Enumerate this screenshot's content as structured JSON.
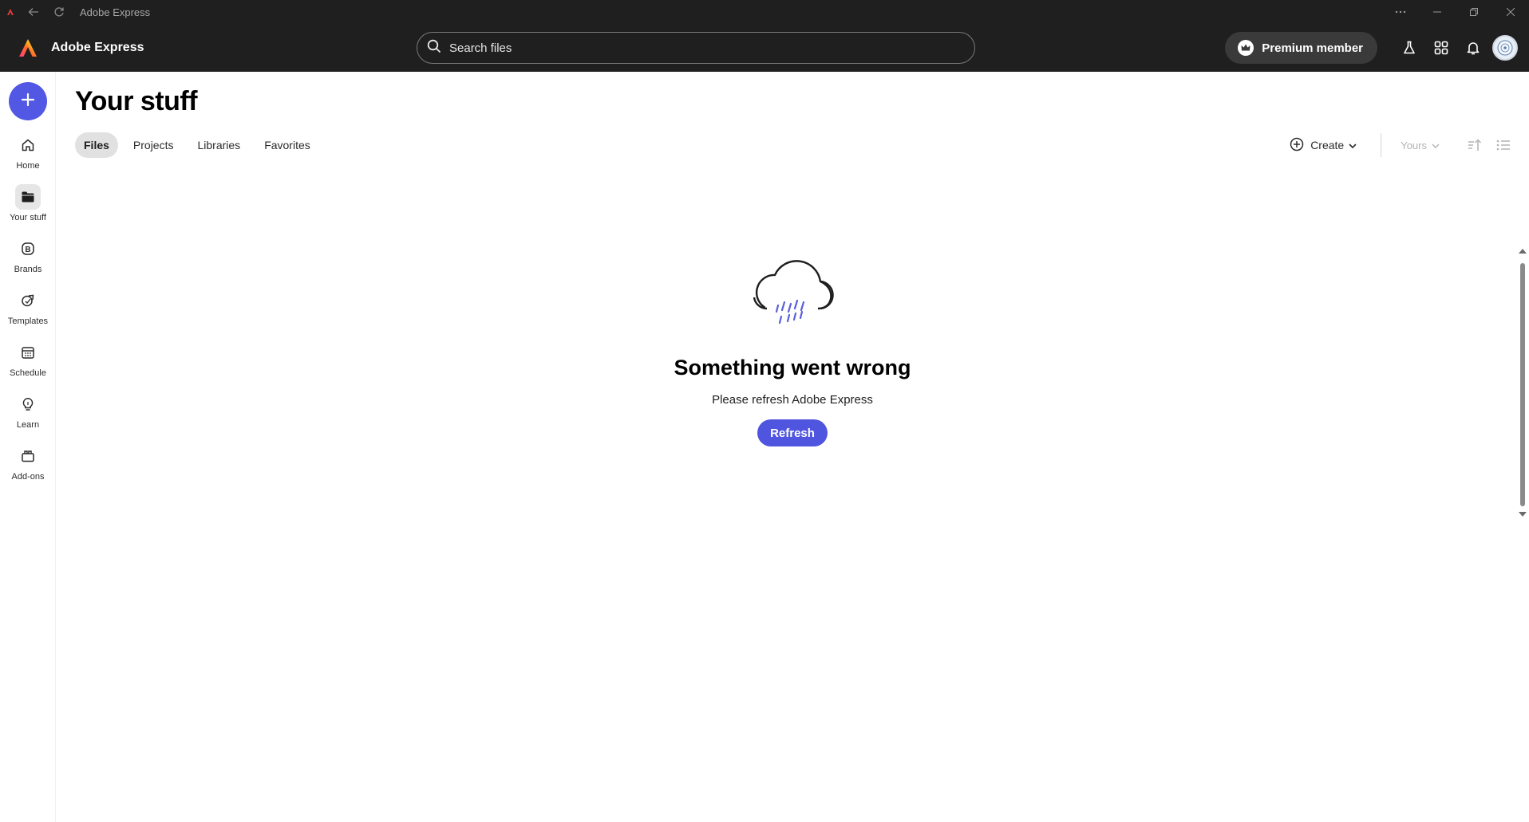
{
  "window": {
    "title": "Adobe Express"
  },
  "header": {
    "brand_name": "Adobe Express",
    "search_placeholder": "Search files",
    "premium_label": "Premium member"
  },
  "rail": {
    "items": [
      {
        "label": "Home",
        "icon": "home-icon"
      },
      {
        "label": "Your stuff",
        "icon": "folder-icon"
      },
      {
        "label": "Brands",
        "icon": "brand-icon"
      },
      {
        "label": "Templates",
        "icon": "templates-icon"
      },
      {
        "label": "Schedule",
        "icon": "calendar-icon"
      },
      {
        "label": "Learn",
        "icon": "lightbulb-icon"
      },
      {
        "label": "Add-ons",
        "icon": "addons-icon"
      }
    ],
    "active": "Your stuff"
  },
  "main": {
    "title": "Your stuff",
    "tabs": [
      {
        "label": "Files",
        "active": true
      },
      {
        "label": "Projects",
        "active": false
      },
      {
        "label": "Libraries",
        "active": false
      },
      {
        "label": "Favorites",
        "active": false
      }
    ],
    "toolbar": {
      "create_label": "Create",
      "filter_label": "Yours"
    }
  },
  "error": {
    "title": "Something went wrong",
    "message": "Please refresh Adobe Express",
    "button_label": "Refresh"
  },
  "colors": {
    "accent": "#5258e4",
    "header_bg": "#1f1f1f"
  }
}
